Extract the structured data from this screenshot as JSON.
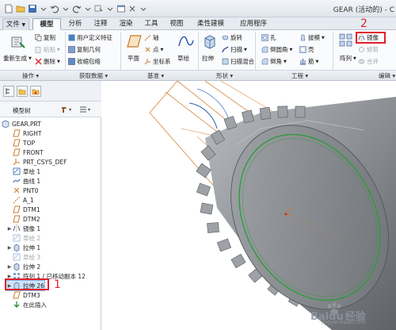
{
  "window": {
    "title": "GEAR (活动的) - C"
  },
  "tabs": [
    {
      "label": "文件"
    },
    {
      "label": "模型"
    },
    {
      "label": "分析"
    },
    {
      "label": "注释"
    },
    {
      "label": "渲染"
    },
    {
      "label": "工具"
    },
    {
      "label": "视图"
    },
    {
      "label": "柔性建模"
    },
    {
      "label": "应用程序"
    }
  ],
  "ribbon": {
    "regenerate": "重新生成",
    "copy": "复制",
    "paste": "粘贴",
    "delete": "删除",
    "user_defined_feature": "用户定义特征",
    "copy_geometry": "复制几何",
    "shrinkwrap": "收缩包络",
    "plane": "平面",
    "axis": "轴",
    "point": "点",
    "coordinate_system": "坐标系",
    "sketch": "草绘",
    "extrude": "拉伸",
    "revolve": "旋转",
    "sweep": "扫描",
    "swept_blend": "扫描混合",
    "hole": "孔",
    "round": "倒圆角",
    "chamfer": "倒角",
    "draft": "拔模",
    "shell": "壳",
    "rib": "筋",
    "pattern": "阵列",
    "mirror": "镜像",
    "modify": "修剪",
    "merge": "合并",
    "groups": {
      "operations": "操作",
      "get_data": "获取数据",
      "datum": "基准",
      "shapes": "形状",
      "engineering": "工程",
      "editing": "编辑"
    }
  },
  "tree": {
    "title": "模型树",
    "items": [
      {
        "label": "GEAR.PRT"
      },
      {
        "label": "RIGHT"
      },
      {
        "label": "TOP"
      },
      {
        "label": "FRONT"
      },
      {
        "label": "PRT_CSYS_DEF"
      },
      {
        "label": "草绘 1"
      },
      {
        "label": "曲线 1"
      },
      {
        "label": "PNT0"
      },
      {
        "label": "A_1"
      },
      {
        "label": "DTM1"
      },
      {
        "label": "DTM2"
      },
      {
        "label": "镜像 1"
      },
      {
        "label": "草绘 2"
      },
      {
        "label": "拉伸 1"
      },
      {
        "label": "草绘 3"
      },
      {
        "label": "拉伸 2"
      },
      {
        "label": "阵列 1 / 已移动副本 12"
      },
      {
        "label": "拉伸 26"
      },
      {
        "label": "DTM3"
      },
      {
        "label": "在此插入"
      }
    ]
  },
  "annotations": {
    "one": "1",
    "two": "2"
  },
  "watermark": {
    "brand": "Baidu",
    "suffix": "经验",
    "url": "jingyan.baidu.com"
  },
  "colors": {
    "accent": "#e0212b",
    "selection": "#cde3fa",
    "gear": "#8a8d91",
    "datum": "#d3873a"
  }
}
